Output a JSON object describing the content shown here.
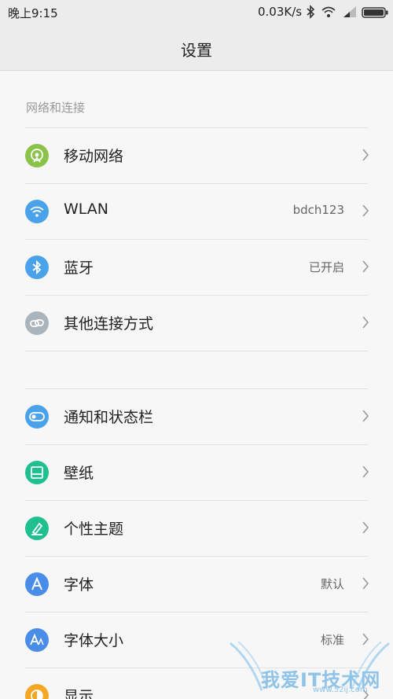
{
  "status_bar": {
    "time": "晚上9:15",
    "net_speed": "0.03K/s",
    "icons": [
      "bluetooth-icon",
      "wifi-icon",
      "signal-icon",
      "battery-icon"
    ]
  },
  "header": {
    "title": "设置"
  },
  "sections": [
    {
      "label": "网络和连接",
      "items": [
        {
          "label": "移动网络",
          "value": "",
          "icon": "mobile-network-icon",
          "icon_color": "#8bc34a"
        },
        {
          "label": "WLAN",
          "value": "bdch123",
          "icon": "wifi-icon",
          "icon_color": "#4aa3ea"
        },
        {
          "label": "蓝牙",
          "value": "已开启",
          "icon": "bluetooth-icon",
          "icon_color": "#4aa3ea"
        },
        {
          "label": "其他连接方式",
          "value": "",
          "icon": "link-icon",
          "icon_color": "#aab4bd"
        }
      ]
    },
    {
      "label": "",
      "items": [
        {
          "label": "通知和状态栏",
          "value": "",
          "icon": "toggle-icon",
          "icon_color": "#4aa3ea"
        },
        {
          "label": "壁纸",
          "value": "",
          "icon": "wallpaper-icon",
          "icon_color": "#1fbf8f"
        },
        {
          "label": "个性主题",
          "value": "",
          "icon": "theme-brush-icon",
          "icon_color": "#1fbf8f"
        },
        {
          "label": "字体",
          "value": "默认",
          "icon": "font-icon",
          "icon_color": "#4a8de8"
        },
        {
          "label": "字体大小",
          "value": "标准",
          "icon": "font-size-icon",
          "icon_color": "#4a8de8"
        },
        {
          "label": "显示",
          "value": "",
          "icon": "display-icon",
          "icon_color": "#f5a623"
        }
      ]
    }
  ],
  "watermark": {
    "text": "我爱IT技术网",
    "sub": "www.52ij.com"
  }
}
